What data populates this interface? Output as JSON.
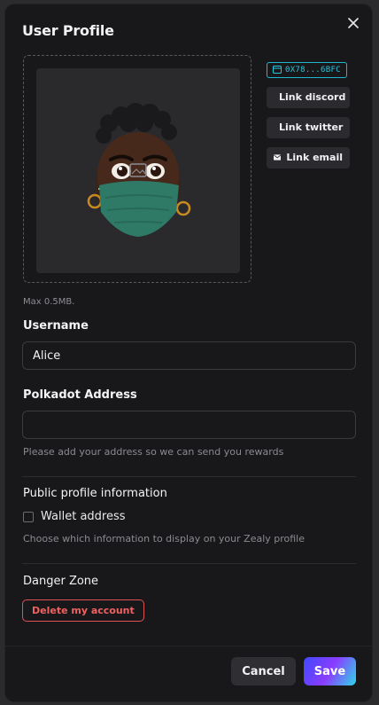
{
  "modal": {
    "title": "User Profile",
    "close_icon": "close-icon"
  },
  "profile": {
    "wallet_chip": "0X78...6BFC",
    "wallet_icon": "wallet-icon",
    "links": [
      {
        "icon": "discord-icon",
        "label": "Link discord"
      },
      {
        "icon": "twitter-icon",
        "label": "Link twitter"
      },
      {
        "icon": "email-icon",
        "label": "Link email"
      }
    ],
    "upload_hint": "Max 0.5MB."
  },
  "username": {
    "label": "Username",
    "value": "Alice"
  },
  "polkadot": {
    "label": "Polkadot Address",
    "value": "",
    "help": "Please add your address so we can send you rewards"
  },
  "public_info": {
    "title": "Public profile information",
    "checkbox_label": "Wallet address",
    "checked": false,
    "help": "Choose which information to display on your Zealy profile"
  },
  "danger": {
    "title": "Danger Zone",
    "delete_label": "Delete my account"
  },
  "footer": {
    "cancel_label": "Cancel",
    "save_label": "Save"
  },
  "colors": {
    "background": "#18181b",
    "wallet_accent": "#27c6dd",
    "danger": "#ef6262",
    "save_gradient": [
      "#3f4bff",
      "#8a3cff",
      "#2fd7e8"
    ]
  }
}
